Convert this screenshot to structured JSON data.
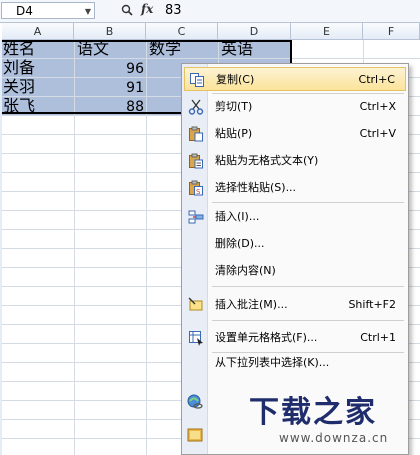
{
  "formula_bar": {
    "name_box": "D4",
    "formula_value": "83"
  },
  "columns": [
    "A",
    "B",
    "C",
    "D",
    "E",
    "F"
  ],
  "cells": {
    "A1": "姓名",
    "B1": "语文",
    "C1": "数学",
    "D1": "英语",
    "A2": "刘备",
    "B2": "96",
    "A3": "关羽",
    "B3": "91",
    "A4": "张飞",
    "B4": "88"
  },
  "context_menu": {
    "items": [
      {
        "label": "复制(C)",
        "shortcut": "Ctrl+C",
        "icon": "copy-icon"
      },
      {
        "label": "剪切(T)",
        "shortcut": "Ctrl+X",
        "icon": "scissors-icon"
      },
      {
        "label": "粘贴(P)",
        "shortcut": "Ctrl+V",
        "icon": "paste-icon"
      },
      {
        "label": "粘贴为无格式文本(Y)",
        "shortcut": "",
        "icon": "paste-text-icon"
      },
      {
        "label": "选择性粘贴(S)...",
        "shortcut": "",
        "icon": "paste-special-icon"
      },
      {
        "label": "插入(I)...",
        "shortcut": "",
        "icon": "insert-icon"
      },
      {
        "label": "删除(D)...",
        "shortcut": "",
        "icon": ""
      },
      {
        "label": "清除内容(N)",
        "shortcut": "",
        "icon": ""
      },
      {
        "label": "插入批注(M)...",
        "shortcut": "Shift+F2",
        "icon": "comment-icon"
      },
      {
        "label": "设置单元格格式(F)...",
        "shortcut": "Ctrl+1",
        "icon": "format-cells-icon"
      },
      {
        "label": "从下拉列表中选择(K)...",
        "shortcut": "",
        "icon": ""
      }
    ]
  },
  "watermark": {
    "title": "下载之家",
    "url": "www.downza.cn"
  },
  "colors": {
    "selection": "#aebfdc",
    "menu_highlight": "#fbe39a",
    "header_selected": "#f1c15f"
  }
}
